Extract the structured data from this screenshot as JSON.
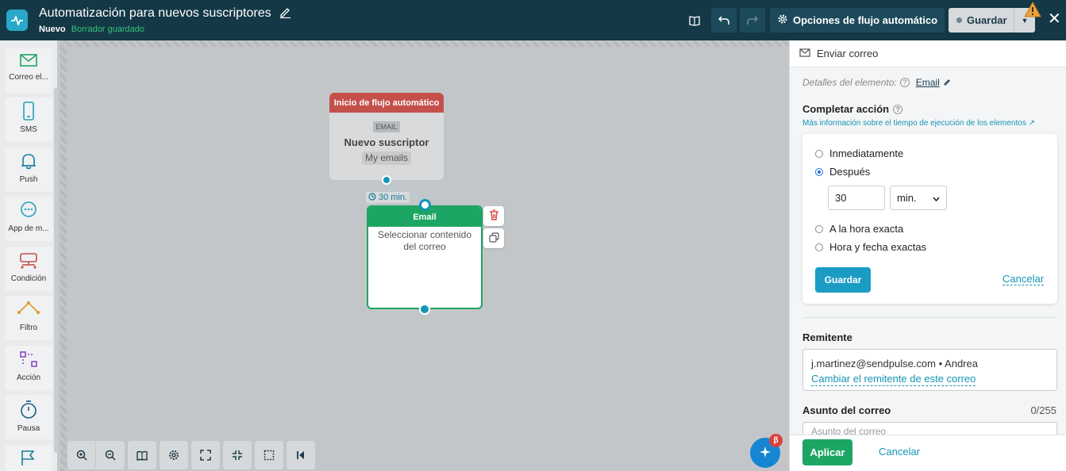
{
  "header": {
    "title": "Automatización para nuevos suscriptores",
    "status": "Nuevo",
    "saved_status": "Borrador guardado",
    "options_label": "Opciones de flujo automático",
    "save_label": "Guardar"
  },
  "sidebar": {
    "items": [
      {
        "label": "Correo el...",
        "icon": "mail-icon"
      },
      {
        "label": "SMS",
        "icon": "phone-icon"
      },
      {
        "label": "Push",
        "icon": "bell-icon"
      },
      {
        "label": "App de m...",
        "icon": "chat-icon"
      },
      {
        "label": "Condición",
        "icon": "condition-icon"
      },
      {
        "label": "Filtro",
        "icon": "filter-icon"
      },
      {
        "label": "Acción",
        "icon": "action-icon"
      },
      {
        "label": "Pausa",
        "icon": "timer-icon"
      }
    ]
  },
  "flow": {
    "start_node": {
      "title": "Inicio de flujo automático",
      "tag": "EMAIL",
      "name": "Nuevo suscriptor",
      "list": "My emails"
    },
    "delay": "30 min.",
    "email_node": {
      "title": "Email",
      "body": "Seleccionar contenido del correo"
    }
  },
  "ai_badge": "β",
  "panel": {
    "header": "Enviar correo",
    "details_label": "Detalles del elemento:",
    "details_value": "Email",
    "complete_label": "Completar acción",
    "more_info": "Más información sobre el tiempo de ejecución de los elementos",
    "options": [
      "Inmediatamente",
      "Después",
      "A la hora exacta",
      "Hora y fecha exactas"
    ],
    "selected_option": "Después",
    "delay_value": "30",
    "delay_unit": "min.",
    "save_label": "Guardar",
    "cancel_label": "Cancelar",
    "sender_label": "Remitente",
    "sender_value": "j.martinez@sendpulse.com • Andrea",
    "sender_change": "Cambiar el remitente de este correo",
    "subject_label": "Asunto del correo",
    "subject_count": "0/255",
    "subject_placeholder": "Asunto del correo",
    "apply_label": "Aplicar",
    "cancel_footer": "Cancelar"
  }
}
